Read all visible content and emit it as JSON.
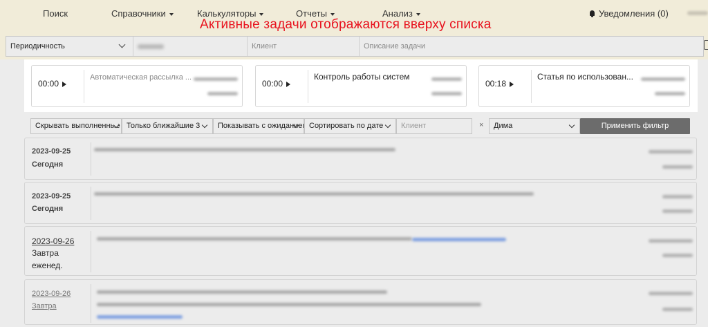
{
  "nav": {
    "search": "Поиск",
    "directories": "Справочники",
    "calculators": "Калькуляторы",
    "reports": "Отчеты",
    "analysis": "Анализ",
    "notifications": "Уведомления (0)"
  },
  "banner": "Активные задачи отображаются вверху списка",
  "filters_top": {
    "periodicity": "Периодичность",
    "client_placeholder": "Клиент",
    "description_placeholder": "Описание задачи"
  },
  "active_tasks": [
    {
      "time": "00:00",
      "title": "Автоматическая рассылка ..."
    },
    {
      "time": "00:00",
      "title": "Контроль работы систем"
    },
    {
      "time": "00:18",
      "title": "Статья по использован..."
    }
  ],
  "filters": {
    "hide_completed": "Скрывать выполненные",
    "nearest": "Только ближайшие 3",
    "show_waiting": "Показывать с ожиданием",
    "sort": "Сортировать по дате",
    "client_placeholder": "Клиент",
    "clear": "×",
    "user": "Дима",
    "apply": "Применить фильтр"
  },
  "tasks": [
    {
      "date": "2023-09-25",
      "day": "Сегодня",
      "note": ""
    },
    {
      "date": "2023-09-25",
      "day": "Сегодня",
      "note": ""
    },
    {
      "date": "2023-09-26",
      "day": "Завтра",
      "note": "еженед."
    },
    {
      "date": "2023-09-26",
      "day": "Завтра",
      "note": ""
    }
  ],
  "colors": {
    "background": "#f1ecd9",
    "banner": "#e8121e",
    "panel": "#ececec",
    "apply_button": "#6c6c6c"
  }
}
